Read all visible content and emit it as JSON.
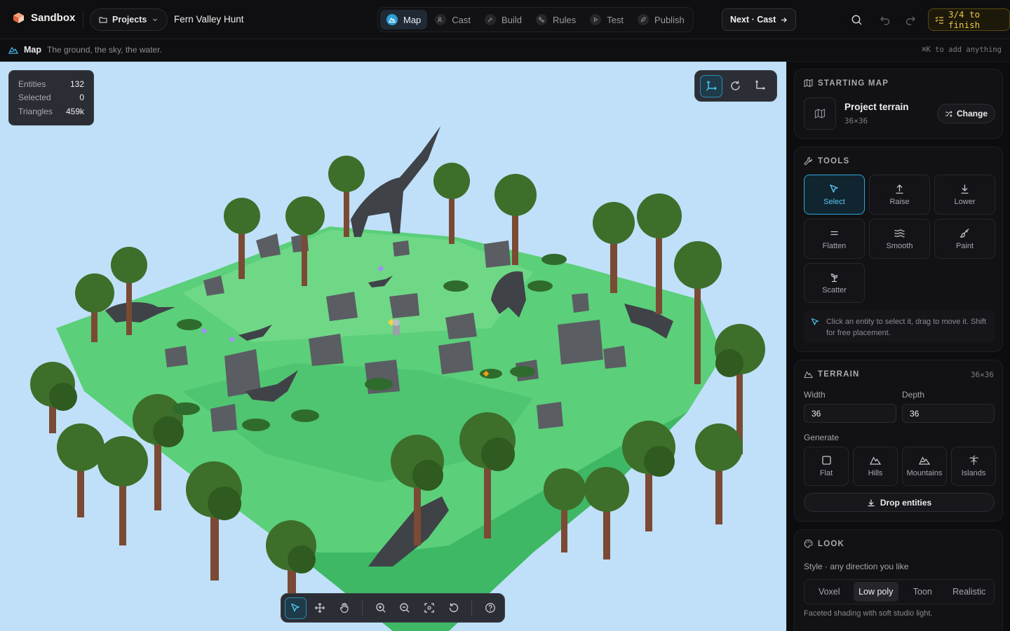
{
  "app": {
    "name": "Sandbox",
    "accent": "#2aa6d8"
  },
  "header": {
    "projects_label": "Projects",
    "project_name": "Fern Valley Hunt",
    "tabs": [
      {
        "label": "Map",
        "icon": "terrain-icon",
        "active": true
      },
      {
        "label": "Cast",
        "icon": "users-icon"
      },
      {
        "label": "Build",
        "icon": "hammer-icon"
      },
      {
        "label": "Rules",
        "icon": "rules-icon"
      },
      {
        "label": "Test",
        "icon": "play-icon"
      },
      {
        "label": "Publish",
        "icon": "rocket-icon"
      }
    ],
    "next_label": "Next · Cast",
    "progress_label": "3/4 to finish"
  },
  "subbar": {
    "title": "Map",
    "description": "The ground, the sky, the water.",
    "hint": "⌘K to add anything"
  },
  "viewport": {
    "sky_color": "#bfe0f8",
    "stats": [
      {
        "label": "Entities",
        "value": "132"
      },
      {
        "label": "Selected",
        "value": "0"
      },
      {
        "label": "Triangles",
        "value": "459k"
      }
    ]
  },
  "starting_map": {
    "heading": "STARTING MAP",
    "title": "Project terrain",
    "size": "36×36",
    "change_label": "Change"
  },
  "tools": {
    "heading": "TOOLS",
    "items": [
      {
        "label": "Select",
        "icon": "cursor-icon",
        "active": true
      },
      {
        "label": "Raise",
        "icon": "raise-icon"
      },
      {
        "label": "Lower",
        "icon": "lower-icon"
      },
      {
        "label": "Flatten",
        "icon": "flatten-icon"
      },
      {
        "label": "Smooth",
        "icon": "smooth-icon"
      },
      {
        "label": "Paint",
        "icon": "brush-icon"
      },
      {
        "label": "Scatter",
        "icon": "scatter-icon"
      }
    ],
    "hint": "Click an entity to select it, drag to move it. Shift for free placement."
  },
  "terrain": {
    "heading": "TERRAIN",
    "size": "36×36",
    "width_label": "Width",
    "width_value": "36",
    "depth_label": "Depth",
    "depth_value": "36",
    "generate_label": "Generate",
    "presets": [
      {
        "label": "Flat",
        "icon": "square-icon"
      },
      {
        "label": "Hills",
        "icon": "hills-icon"
      },
      {
        "label": "Mountains",
        "icon": "mountains-icon"
      },
      {
        "label": "Islands",
        "icon": "palm-icon"
      }
    ],
    "drop_label": "Drop entities"
  },
  "look": {
    "heading": "LOOK",
    "style_label": "Style · any direction you like",
    "styles": [
      {
        "label": "Voxel"
      },
      {
        "label": "Low poly",
        "active": true
      },
      {
        "label": "Toon"
      },
      {
        "label": "Realistic"
      }
    ],
    "description": "Faceted shading with soft studio light."
  }
}
